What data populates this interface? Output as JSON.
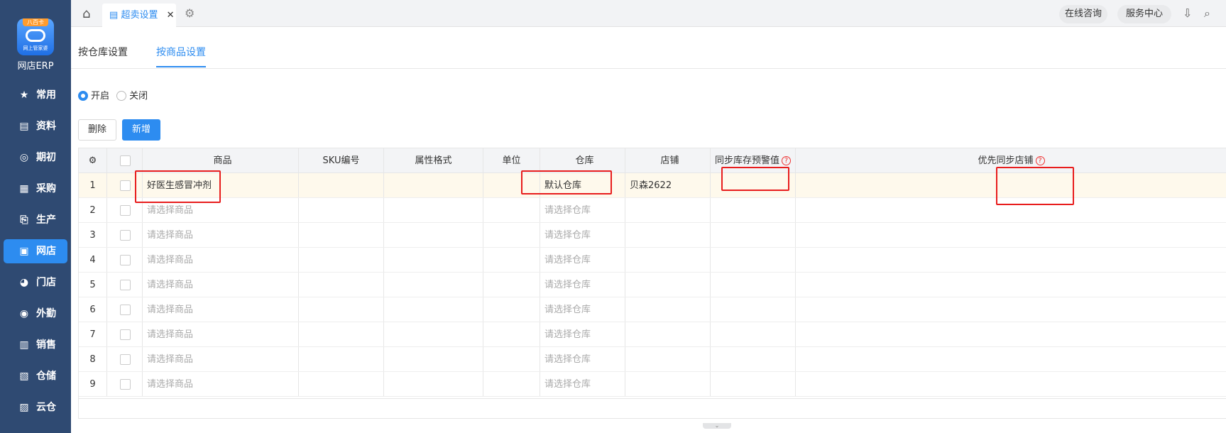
{
  "sidebar": {
    "logo_badge": "八百卡",
    "logo_text": "网上管家婆",
    "brand": "网店ERP",
    "items": [
      {
        "label": "常用",
        "icon": "star-icon",
        "glyph": "★"
      },
      {
        "label": "资料",
        "icon": "document-icon",
        "glyph": "▤"
      },
      {
        "label": "期初",
        "icon": "target-icon",
        "glyph": "◎"
      },
      {
        "label": "采购",
        "icon": "purchase-icon",
        "glyph": "▦"
      },
      {
        "label": "生产",
        "icon": "production-icon",
        "glyph": "⎘"
      },
      {
        "label": "网店",
        "icon": "store-icon",
        "glyph": "▣",
        "active": true
      },
      {
        "label": "门店",
        "icon": "pie-icon",
        "glyph": "◕"
      },
      {
        "label": "外勤",
        "icon": "field-icon",
        "glyph": "◉"
      },
      {
        "label": "销售",
        "icon": "chart-icon",
        "glyph": "▥"
      },
      {
        "label": "仓储",
        "icon": "warehouse-icon",
        "glyph": "▧"
      },
      {
        "label": "云仓",
        "icon": "cloud-warehouse-icon",
        "glyph": "▨"
      }
    ]
  },
  "topbar": {
    "active_tab": "超卖设置",
    "online_consult": "在线咨询",
    "service_center": "服务中心"
  },
  "subtabs": {
    "by_warehouse": "按仓库设置",
    "by_product": "按商品设置"
  },
  "mode": {
    "on_label": "开启",
    "off_label": "关闭",
    "selected": "开启"
  },
  "actions": {
    "delete": "删除",
    "add": "新增"
  },
  "table": {
    "headers": {
      "product": "商品",
      "sku": "SKU编号",
      "attr": "属性格式",
      "unit": "单位",
      "warehouse": "仓库",
      "shop": "店铺",
      "warn": "同步库存预警值",
      "priority": "优先同步店铺"
    },
    "help_glyph": "?",
    "rows": [
      {
        "idx": "1",
        "product": "好医生感冒冲剂",
        "warehouse": "默认仓库",
        "shop": "贝森2622"
      },
      {
        "idx": "2",
        "product": "请选择商品",
        "warehouse": "请选择仓库",
        "shop": ""
      },
      {
        "idx": "3",
        "product": "请选择商品",
        "warehouse": "请选择仓库",
        "shop": ""
      },
      {
        "idx": "4",
        "product": "请选择商品",
        "warehouse": "请选择仓库",
        "shop": ""
      },
      {
        "idx": "5",
        "product": "请选择商品",
        "warehouse": "请选择仓库",
        "shop": ""
      },
      {
        "idx": "6",
        "product": "请选择商品",
        "warehouse": "请选择仓库",
        "shop": ""
      },
      {
        "idx": "7",
        "product": "请选择商品",
        "warehouse": "请选择仓库",
        "shop": ""
      },
      {
        "idx": "8",
        "product": "请选择商品",
        "warehouse": "请选择仓库",
        "shop": ""
      },
      {
        "idx": "9",
        "product": "请选择商品",
        "warehouse": "请选择仓库",
        "shop": ""
      }
    ]
  },
  "colors": {
    "accent": "#2d8cf0",
    "sidebar_bg": "#2f4a72",
    "highlight_box": "#e81d1d",
    "selected_row": "#fef9ec"
  }
}
